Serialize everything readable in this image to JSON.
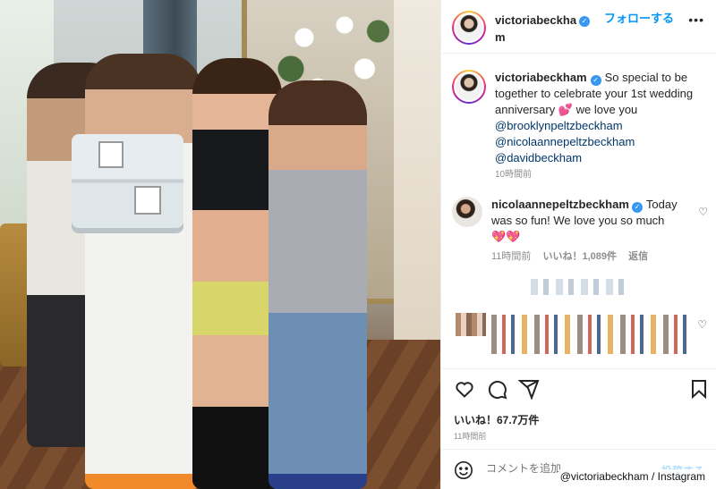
{
  "post": {
    "author": "victoriabeckham",
    "follow_label": "フォローする",
    "more_label": "•••",
    "verified_glyph": "✓"
  },
  "caption": {
    "author": "victoriabeckham",
    "text": "So special to be together to celebrate your 1st wedding anniversary",
    "heart": "💕",
    "tail": " we love you",
    "mentions": [
      "@brooklynpeltzbeckham",
      "@nicolaannepeltzbeckham",
      "@davidbeckham"
    ],
    "time": "10時間前"
  },
  "comment": {
    "author": "nicolaannepeltzbeckham",
    "text": "Today was so fun! We love you so much",
    "hearts": "💖💖",
    "time": "11時間前",
    "likes": "いいね！1,089件",
    "reply": "返信"
  },
  "actions": {
    "likes": "いいね！67.7万件",
    "time": "11時間前"
  },
  "composer": {
    "placeholder": "コメントを追加...",
    "post_label": "投稿する",
    "emoji": "☺"
  },
  "credit": "@victoriabeckham / Instagram",
  "colors": {
    "link": "#00376b",
    "follow": "#0095f6",
    "verified": "#3897f0",
    "muted": "#8e8e8e"
  },
  "icons": [
    "heart-icon",
    "comment-icon",
    "share-icon",
    "bookmark-icon",
    "emoji-icon",
    "verified-icon",
    "more-icon"
  ]
}
